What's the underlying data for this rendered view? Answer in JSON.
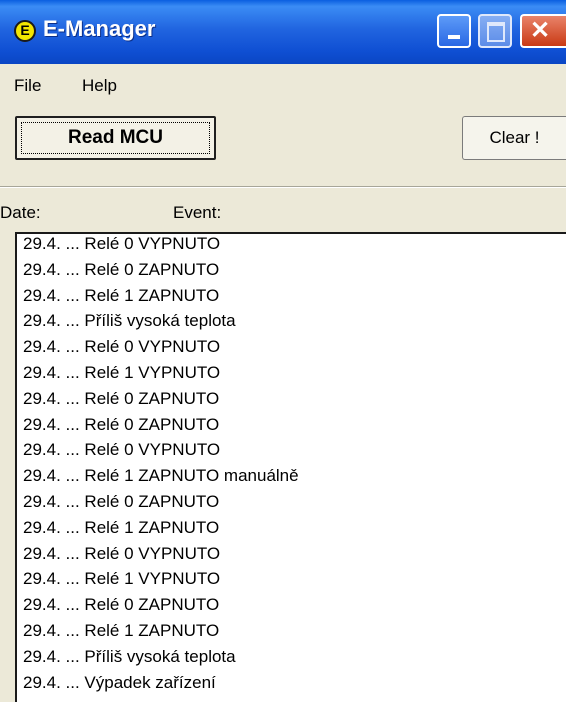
{
  "window": {
    "title": "E-Manager",
    "app_icon_letter": "E"
  },
  "menu": {
    "file": "File",
    "help": "Help"
  },
  "toolbar": {
    "read_label": "Read MCU",
    "clear_label": "Clear !"
  },
  "columns": {
    "date": "Date:",
    "event": "Event:"
  },
  "events": [
    "29.4. ... Relé 0 VYPNUTO",
    "29.4. ... Relé 0 ZAPNUTO",
    "29.4. ... Relé 1 ZAPNUTO",
    "29.4. ... Příliš vysoká teplota",
    "29.4. ... Relé 0 VYPNUTO",
    "29.4. ... Relé 1 VYPNUTO",
    "29.4. ... Relé 0 ZAPNUTO",
    "29.4. ... Relé 0 ZAPNUTO",
    "29.4. ... Relé 0 VYPNUTO",
    "29.4. ... Relé 1 ZAPNUTO manuálně",
    "29.4. ... Relé 0 ZAPNUTO",
    "29.4. ... Relé 1 ZAPNUTO",
    "29.4. ... Relé 0 VYPNUTO",
    "29.4. ... Relé 1 VYPNUTO",
    "29.4. ... Relé 0 ZAPNUTO",
    "29.4. ... Relé 1 ZAPNUTO",
    "29.4. ... Příliš vysoká teplota",
    "29.4. ... Výpadek zařízení"
  ]
}
